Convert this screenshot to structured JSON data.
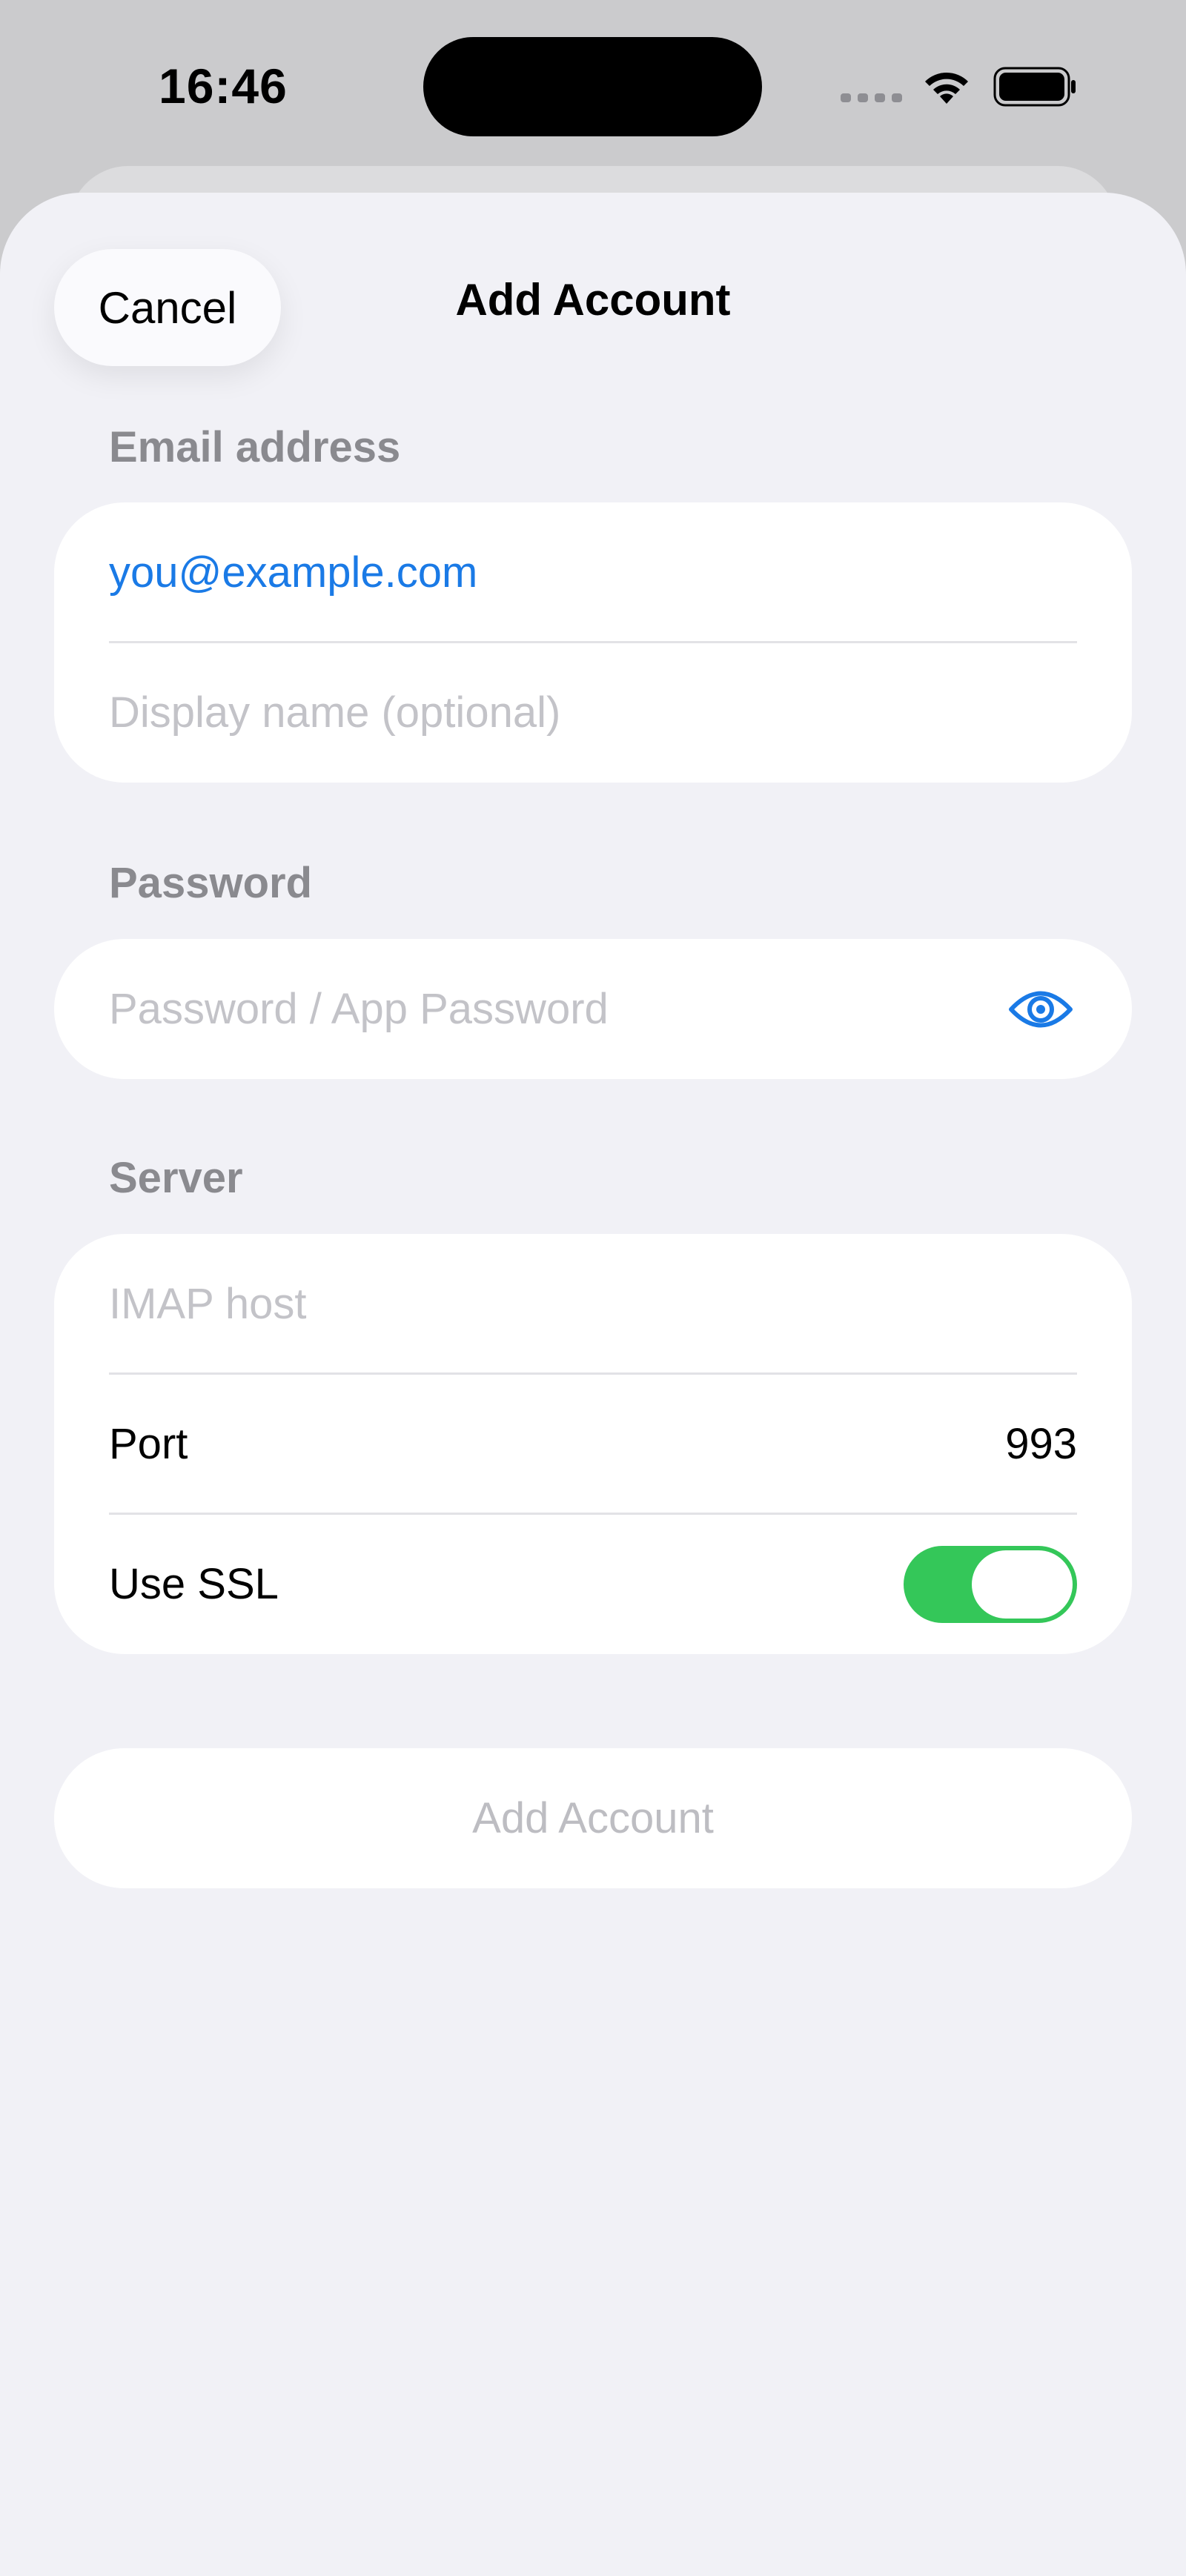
{
  "status_bar": {
    "time": "16:46",
    "icons": [
      "cellular-icon",
      "wifi-icon",
      "battery-icon"
    ]
  },
  "nav": {
    "cancel_label": "Cancel",
    "title": "Add Account"
  },
  "email_section": {
    "label": "Email address",
    "email_value": "you@example.com",
    "display_name_placeholder": "Display name (optional)"
  },
  "password_section": {
    "label": "Password",
    "password_placeholder": "Password / App Password",
    "reveal_icon": "eye-icon"
  },
  "server_section": {
    "label": "Server",
    "host_placeholder": "IMAP host",
    "port_label": "Port",
    "port_value": "993",
    "ssl_label": "Use SSL",
    "ssl_enabled": true
  },
  "footer": {
    "add_account_label": "Add Account"
  },
  "colors": {
    "accent": "#1a7ae6",
    "toggle_on": "#34c759",
    "background": "#f1f1f6"
  }
}
